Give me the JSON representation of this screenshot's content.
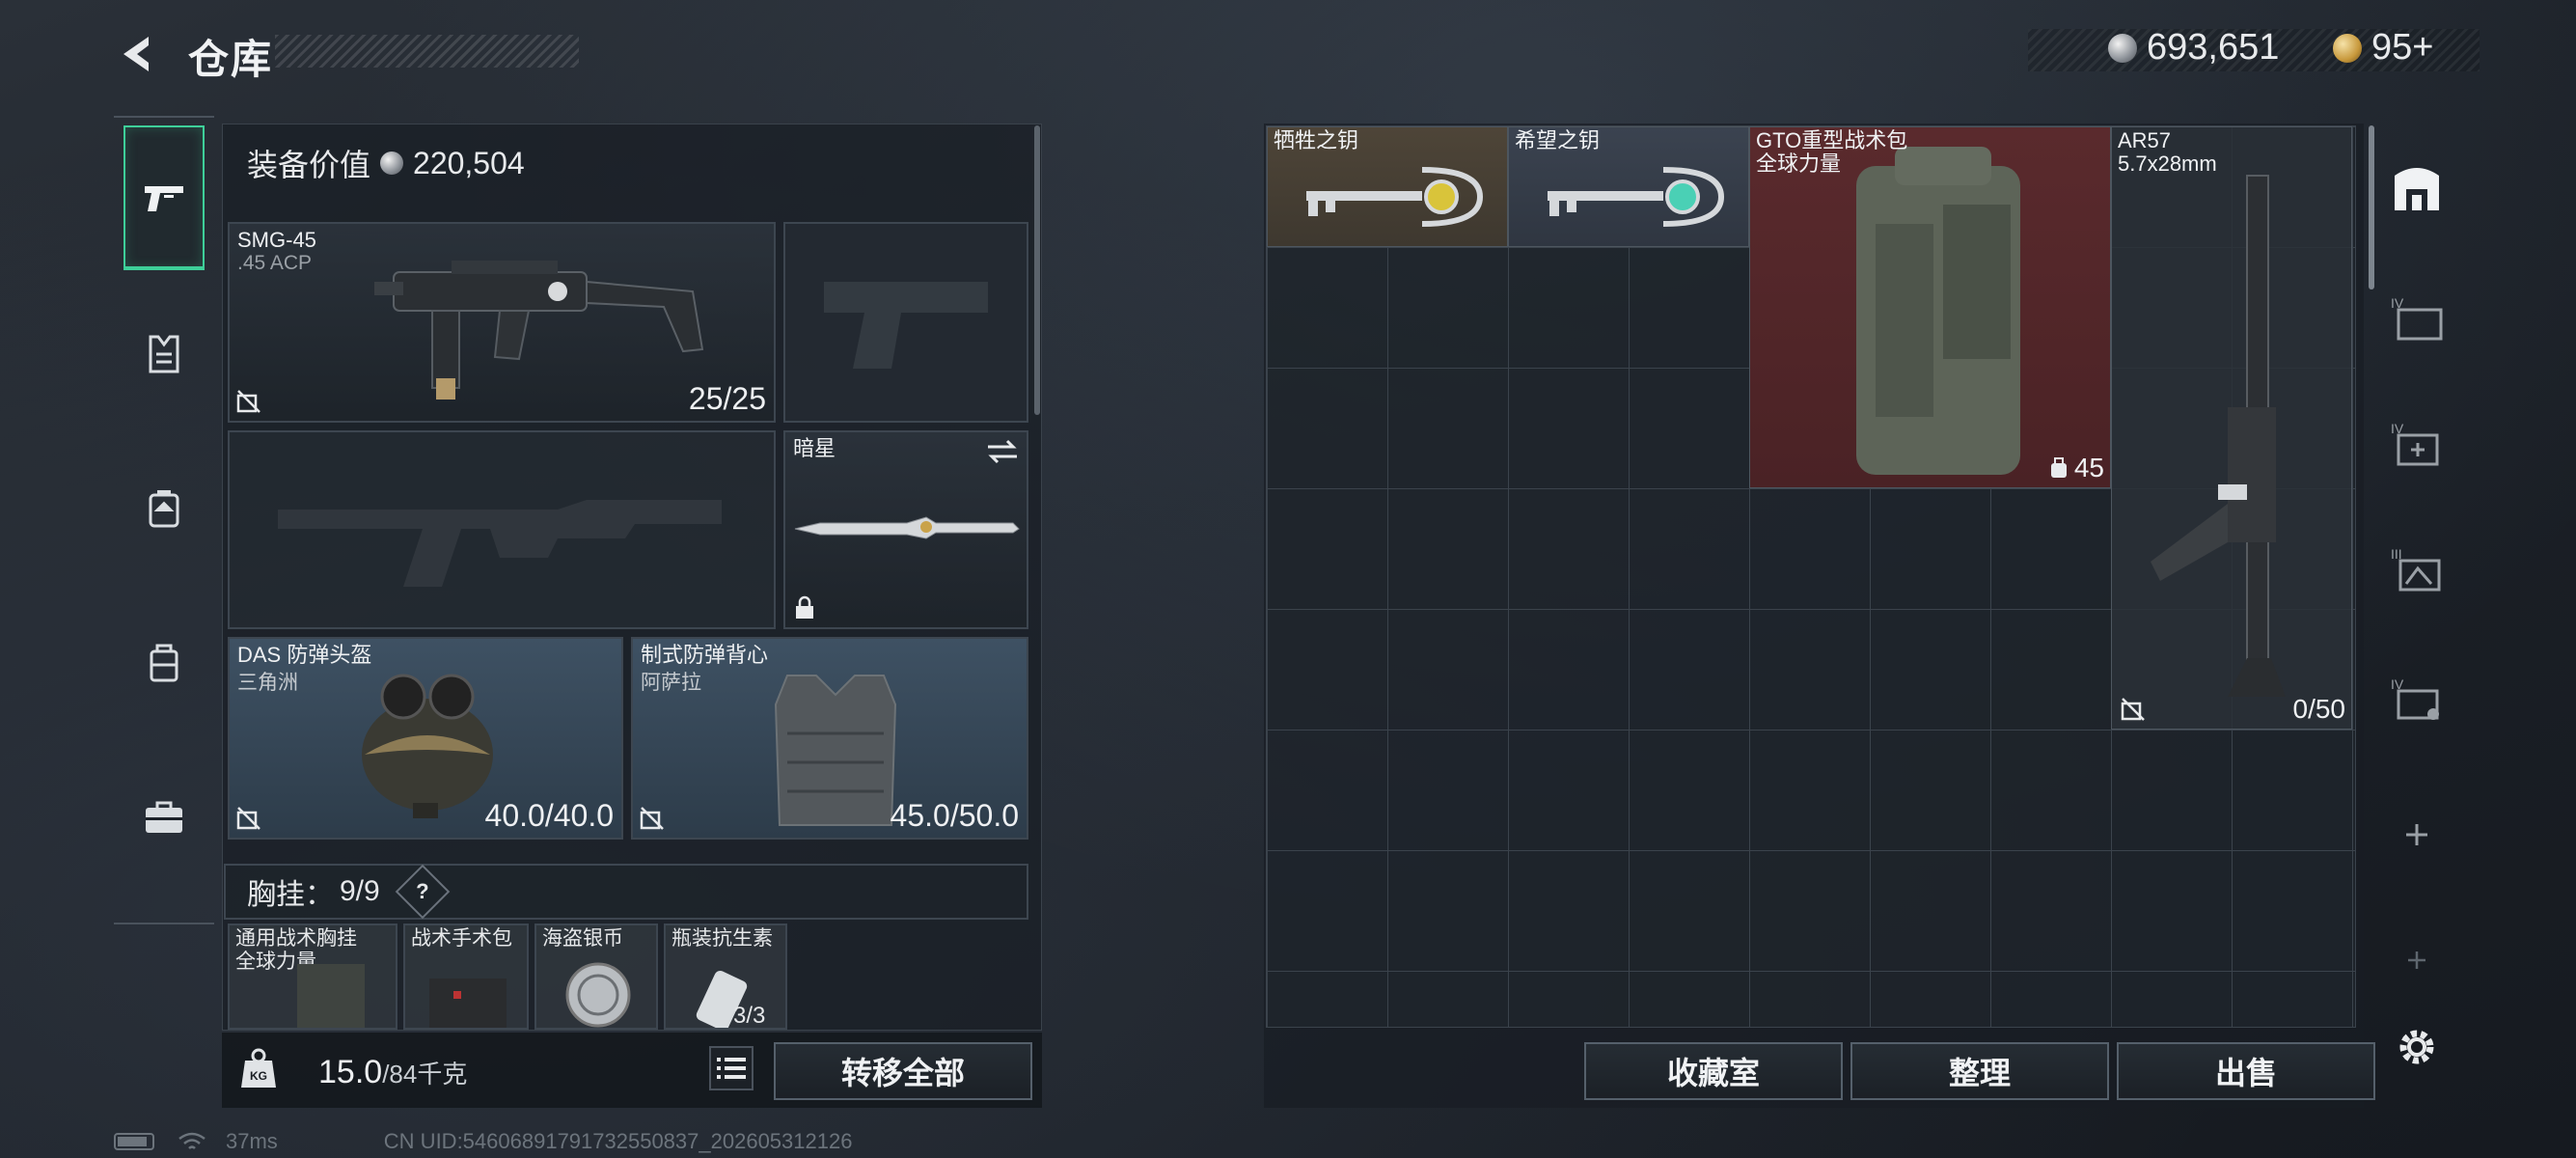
{
  "header": {
    "title": "仓库",
    "currency_silver": "693,651",
    "currency_gold": "95+",
    "colors": {
      "accent_green": "#3ecf99"
    }
  },
  "categories": [
    {
      "icon": "pistol-icon",
      "active": true
    },
    {
      "icon": "vest-icon",
      "active": false
    },
    {
      "icon": "backpack-icon",
      "active": false
    },
    {
      "icon": "bag-icon",
      "active": false
    },
    {
      "icon": "briefcase-icon",
      "active": false
    }
  ],
  "equipment": {
    "value_label": "装备价值",
    "value": "220,504",
    "primary_weapon": {
      "name": "SMG-45",
      "ammo": ".45 ACP",
      "durability": "25/25"
    },
    "melee": {
      "name": "暗星"
    },
    "helmet": {
      "name": "DAS 防弹头盔",
      "origin": "三角洲",
      "durability": "40.0/40.0"
    },
    "vest": {
      "name": "制式防弹背心",
      "origin": "阿萨拉",
      "durability": "45.0/50.0"
    },
    "rig_label": "胸挂：",
    "rig_count": "9/9",
    "rig_help": "?",
    "rig_items": [
      {
        "name": "通用战术胸挂",
        "sub": "全球力量"
      },
      {
        "name": "战术手术包"
      },
      {
        "name": "海盗银币"
      },
      {
        "name": "瓶装抗生素",
        "count": "3/3"
      }
    ]
  },
  "footer_left": {
    "weight": "15.0",
    "weight_max": "/84千克",
    "transfer_all": "转移全部"
  },
  "storage": {
    "items": [
      {
        "name": "牺牲之钥"
      },
      {
        "name": "希望之钥"
      },
      {
        "name": "GTO重型战术包",
        "sub": "全球力量",
        "count": "45"
      },
      {
        "name": "AR57",
        "sub": "5.7x28mm",
        "count": "0/50"
      }
    ],
    "buttons": {
      "collection": "收藏室",
      "sort": "整理",
      "sell": "出售"
    }
  },
  "side_tools": [
    "home-icon",
    "storage-iv-icon",
    "storage-iv-add-icon",
    "storage-iii-icon",
    "storage-iv-lock-icon",
    "plus-icon",
    "plus-icon"
  ],
  "status": {
    "ping": "37ms",
    "uid": "CN UID:546068917917325508​37_202605312126"
  }
}
